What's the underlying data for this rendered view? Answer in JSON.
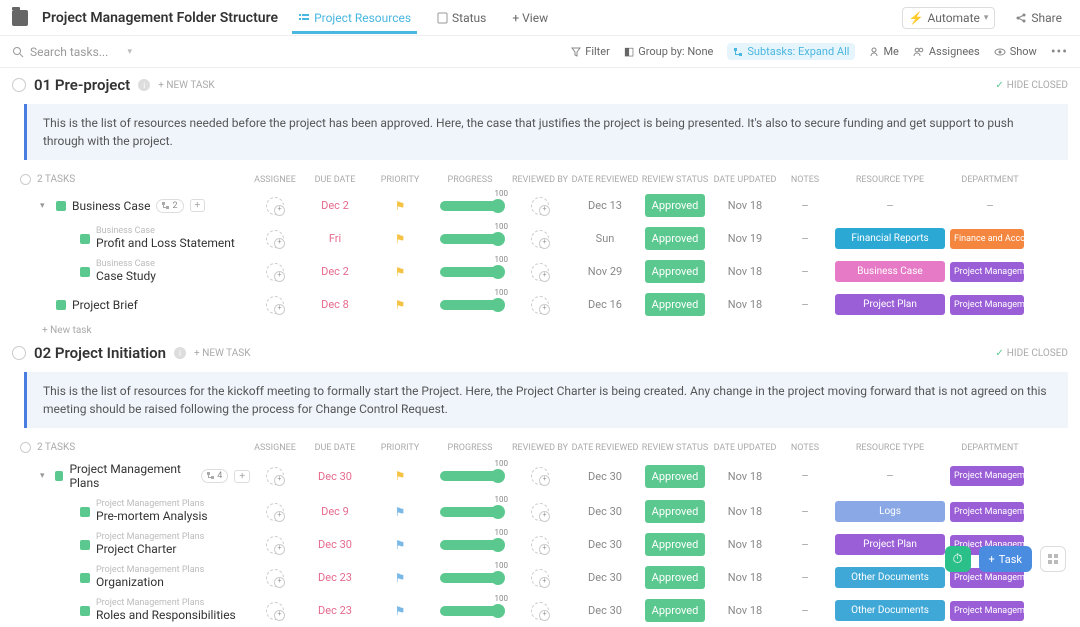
{
  "header": {
    "title": "Project Management Folder Structure",
    "tabs": [
      {
        "label": "Project Resources",
        "active": true
      },
      {
        "label": "Status",
        "active": false
      }
    ],
    "add_view": "+ View",
    "automate": "Automate",
    "share": "Share"
  },
  "filters": {
    "search_placeholder": "Search tasks...",
    "filter": "Filter",
    "group_by": "Group by: None",
    "subtasks": "Subtasks: Expand All",
    "me": "Me",
    "assignees": "Assignees",
    "show": "Show"
  },
  "sections": [
    {
      "title": "01 Pre-project",
      "new_task": "+ NEW TASK",
      "hide_closed": "HIDE CLOSED",
      "desc": "This is the list of resources needed before the project has been approved. Here, the case that justifies the project is being presented. It's also to secure funding and get support to push through with the project.",
      "task_count": "2 TASKS",
      "rows": [
        {
          "indent": 1,
          "tri": true,
          "name": "Business Case",
          "parent": "",
          "chip": "2",
          "plus": true,
          "due": "Dec 2",
          "flag": "y",
          "prog": 100,
          "rev": "Dec 13",
          "status": "Approved",
          "upd": "Nov 18",
          "notes": "–",
          "rtype": "–",
          "rcolor": "",
          "dept": "–",
          "dcolor": ""
        },
        {
          "indent": 2,
          "tri": false,
          "name": "Profit and Loss Statement",
          "parent": "Business Case",
          "chip": "",
          "plus": false,
          "due": "Fri",
          "flag": "y",
          "prog": 100,
          "rev": "Sun",
          "status": "Approved",
          "upd": "Nov 19",
          "notes": "–",
          "rtype": "Financial Reports",
          "rcolor": "t-fin",
          "dept": "Finance and Accou",
          "dcolor": "d-fin"
        },
        {
          "indent": 2,
          "tri": false,
          "name": "Case Study",
          "parent": "Business Case",
          "chip": "",
          "plus": false,
          "due": "Dec 2",
          "flag": "y",
          "prog": 100,
          "rev": "Nov 29",
          "status": "Approved",
          "upd": "Nov 18",
          "notes": "–",
          "rtype": "Business Case",
          "rcolor": "t-biz",
          "dept": "Project Managem",
          "dcolor": "d-pm"
        },
        {
          "indent": 1,
          "tri": false,
          "name": "Project Brief",
          "parent": "",
          "chip": "",
          "plus": false,
          "due": "Dec 8",
          "flag": "y",
          "prog": 100,
          "rev": "Dec 16",
          "status": "Approved",
          "upd": "Nov 18",
          "notes": "–",
          "rtype": "Project Plan",
          "rcolor": "t-pplan",
          "dept": "Project Managem",
          "dcolor": "d-pm"
        }
      ],
      "new_task_row": "+ New task"
    },
    {
      "title": "02 Project Initiation",
      "new_task": "+ NEW TASK",
      "hide_closed": "HIDE CLOSED",
      "desc": "This is the list of resources for the kickoff meeting to formally start the Project. Here, the Project Charter is being created. Any change in the project moving forward that is not agreed on this meeting should be raised following the process for Change Control Request.",
      "task_count": "2 TASKS",
      "rows": [
        {
          "indent": 1,
          "tri": true,
          "name": "Project Management Plans",
          "parent": "",
          "chip": "4",
          "plus": true,
          "due": "Dec 30",
          "flag": "y",
          "prog": 100,
          "rev": "Dec 30",
          "status": "Approved",
          "upd": "Nov 18",
          "notes": "–",
          "rtype": "–",
          "rcolor": "",
          "dept": "Project Managem",
          "dcolor": "d-pm"
        },
        {
          "indent": 2,
          "tri": false,
          "name": "Pre-mortem Analysis",
          "parent": "Project Management Plans",
          "chip": "",
          "plus": false,
          "due": "Dec 9",
          "flag": "b",
          "prog": 100,
          "rev": "Dec 30",
          "status": "Approved",
          "upd": "Nov 18",
          "notes": "–",
          "rtype": "Logs",
          "rcolor": "t-logs",
          "dept": "Project Managem",
          "dcolor": "d-pm"
        },
        {
          "indent": 2,
          "tri": false,
          "name": "Project Charter",
          "parent": "Project Management Plans",
          "chip": "",
          "plus": false,
          "due": "Dec 30",
          "flag": "b",
          "prog": 100,
          "rev": "Dec 30",
          "status": "Approved",
          "upd": "Nov 18",
          "notes": "–",
          "rtype": "Project Plan",
          "rcolor": "t-pplan",
          "dept": "Project Managem",
          "dcolor": "d-pm"
        },
        {
          "indent": 2,
          "tri": false,
          "name": "Organization",
          "parent": "Project Management Plans",
          "chip": "",
          "plus": false,
          "due": "Dec 23",
          "flag": "b",
          "prog": 100,
          "rev": "Dec 30",
          "status": "Approved",
          "upd": "Nov 18",
          "notes": "–",
          "rtype": "Other Documents",
          "rcolor": "t-other",
          "dept": "Project Managem",
          "dcolor": "d-pm"
        },
        {
          "indent": 2,
          "tri": false,
          "name": "Roles and Responsibilities",
          "parent": "Project Management Plans",
          "chip": "",
          "plus": false,
          "due": "Dec 23",
          "flag": "b",
          "prog": 100,
          "rev": "Dec 30",
          "status": "Approved",
          "upd": "Nov 18",
          "notes": "–",
          "rtype": "Other Documents",
          "rcolor": "t-other",
          "dept": "Project Managem",
          "dcolor": "d-pm"
        }
      ]
    }
  ],
  "columns": {
    "assignee": "ASSIGNEE",
    "due": "DUE DATE",
    "priority": "PRIORITY",
    "progress": "PROGRESS",
    "reviewed_by": "REVIEWED BY",
    "date_reviewed": "DATE REVIEWED",
    "review_status": "REVIEW STATUS",
    "date_updated": "DATE UPDATED",
    "notes": "NOTES",
    "resource_type": "RESOURCE TYPE",
    "department": "DEPARTMENT"
  },
  "fab": {
    "task": "Task"
  }
}
